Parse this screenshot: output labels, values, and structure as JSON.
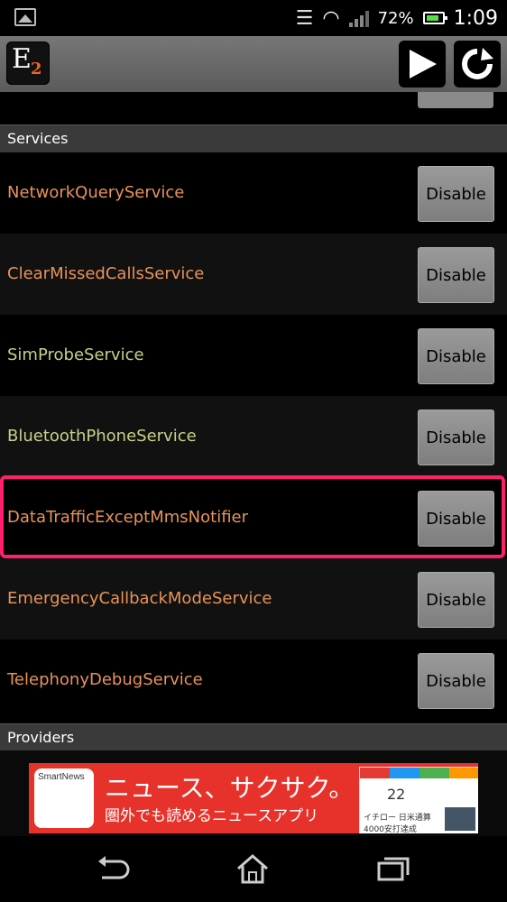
{
  "status_bar": {
    "battery_percent": "72%",
    "time": "1:09",
    "icons": [
      "gallery-icon",
      "vibrate-icon",
      "wifi-icon",
      "signal-icon",
      "battery-icon"
    ]
  },
  "action_bar": {
    "logo_letter": "E",
    "logo_subscript": "2",
    "icons": [
      "play-icon",
      "refresh-icon"
    ]
  },
  "sections": {
    "services_header": "Services",
    "providers_header": "Providers"
  },
  "services": [
    {
      "name": "NetworkQueryService",
      "button": "Disable",
      "color": "#e8935a"
    },
    {
      "name": "ClearMissedCallsService",
      "button": "Disable",
      "color": "#e8935a"
    },
    {
      "name": "SimProbeService",
      "button": "Disable",
      "color": "#c9d08a"
    },
    {
      "name": "BluetoothPhoneService",
      "button": "Disable",
      "color": "#c9d08a"
    },
    {
      "name": "DataTrafficExceptMmsNotifier",
      "button": "Disable",
      "color": "#e8935a"
    },
    {
      "name": "EmergencyCallbackModeService",
      "button": "Disable",
      "color": "#e8935a"
    },
    {
      "name": "TelephonyDebugService",
      "button": "Disable",
      "color": "#e8935a"
    }
  ],
  "ad": {
    "brand": "SmartNews",
    "headline": "ニュース、サクサク。",
    "subline": "圏外でも読めるニュースアプリ",
    "phone_day": "22",
    "phone_news": "イチロー 日米通算 4000安打達成"
  },
  "colors": {
    "highlight": "#ff1f6d",
    "section_bg": "#3a3a3a",
    "actionbar_bg": "#666666"
  },
  "nav_bar": {
    "icons": [
      "back-icon",
      "home-icon",
      "recent-apps-icon"
    ]
  }
}
